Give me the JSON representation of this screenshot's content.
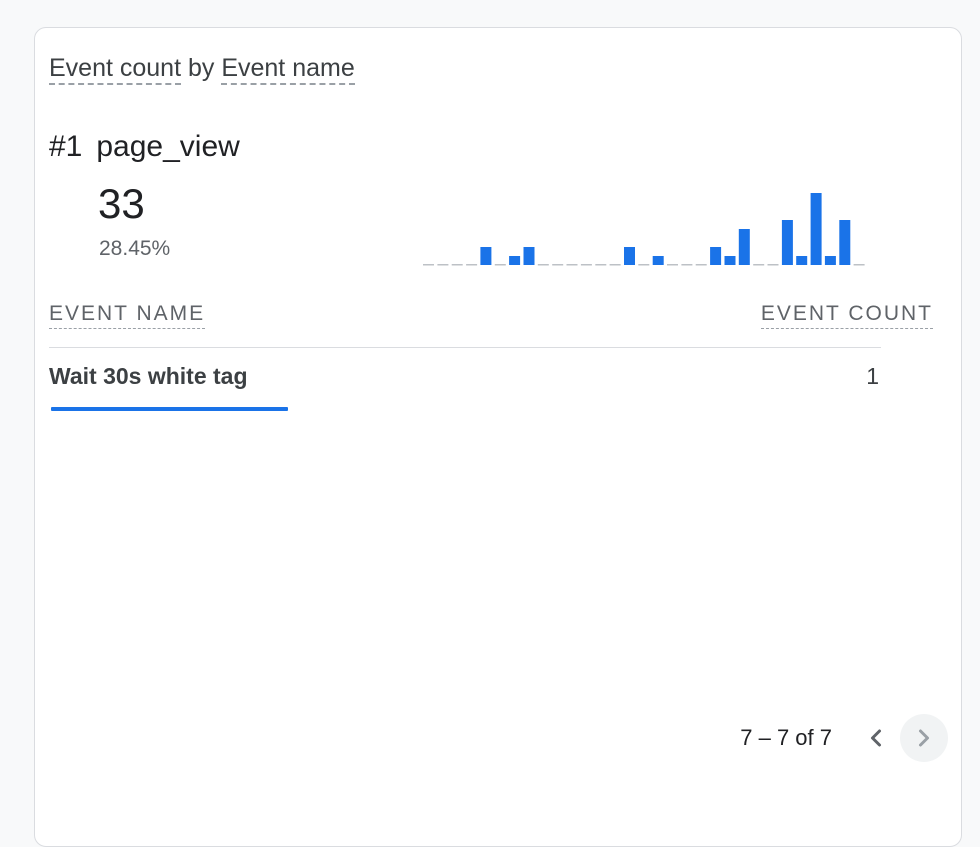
{
  "card": {
    "title_part1": "Event count",
    "title_by": " by ",
    "title_part2": "Event name",
    "top_rank": "#1",
    "top_event": "page_view",
    "top_value": "33",
    "top_percent": "28.45%"
  },
  "chart_data": {
    "type": "bar",
    "values": [
      0,
      0,
      0,
      0,
      1,
      0,
      0.5,
      1,
      0,
      0,
      0,
      0,
      0,
      0,
      1,
      0,
      0.5,
      0,
      0,
      0,
      1,
      0.5,
      2,
      0,
      0,
      2.5,
      0.5,
      4,
      0.5,
      2.5,
      0
    ],
    "xlabel": "",
    "ylabel": ""
  },
  "table": {
    "col_name": "EVENT NAME",
    "col_count": "EVENT COUNT",
    "rows": [
      {
        "name": "Wait 30s white tag",
        "count": "1",
        "bar_fraction": 0.285
      }
    ]
  },
  "pager": {
    "text": "7 – 7 of 7",
    "prev_icon": "chevron-left-icon",
    "next_icon": "chevron-right-icon"
  },
  "colors": {
    "accent": "#1a73e8",
    "baseline": "#bdc1c6"
  }
}
